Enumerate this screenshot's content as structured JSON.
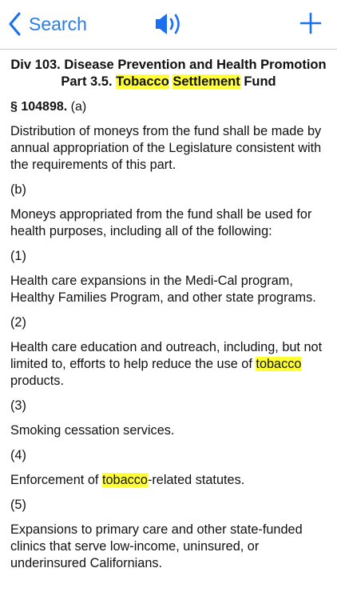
{
  "nav": {
    "back_label": "Search"
  },
  "heading": {
    "div_line": "Div 103. Disease Prevention and Health Promotion",
    "part_prefix": "Part 3.5. ",
    "part_hl1": "Tobacco",
    "part_space": " ",
    "part_hl2": "Settlement",
    "part_suffix": " Fund"
  },
  "section": {
    "number": "§ 104898.",
    "sub": " (a)"
  },
  "paragraphs": {
    "p1": "Distribution of moneys from the fund shall be made by annual appropriation of the Legislature consistent with the requirements of this part.",
    "b_label": "(b)",
    "p2": "Moneys appropriated from the fund shall be used for health purposes, including all of the following:",
    "l1": "(1)",
    "p3": "Health care expansions in the Medi-Cal program, Healthy Families Program, and other state programs.",
    "l2": "(2)",
    "p4_pre": "Health care education and outreach, including, but not limited to, efforts to help reduce the use of ",
    "p4_hl": "tobacco",
    "p4_post": " products.",
    "l3": "(3)",
    "p5": "Smoking cessation services.",
    "l4": "(4)",
    "p6_pre": "Enforcement of ",
    "p6_hl": "tobacco",
    "p6_post": "-related statutes.",
    "l5": "(5)",
    "p7": "Expansions to primary care and other state-funded clinics that serve low-income, uninsured, or underinsured Californians."
  },
  "colors": {
    "accent": "#1a6ff0",
    "highlight": "#ffff33"
  },
  "icons": {
    "back": "chevron-left-icon",
    "speaker": "speaker-icon",
    "add": "plus-icon"
  }
}
